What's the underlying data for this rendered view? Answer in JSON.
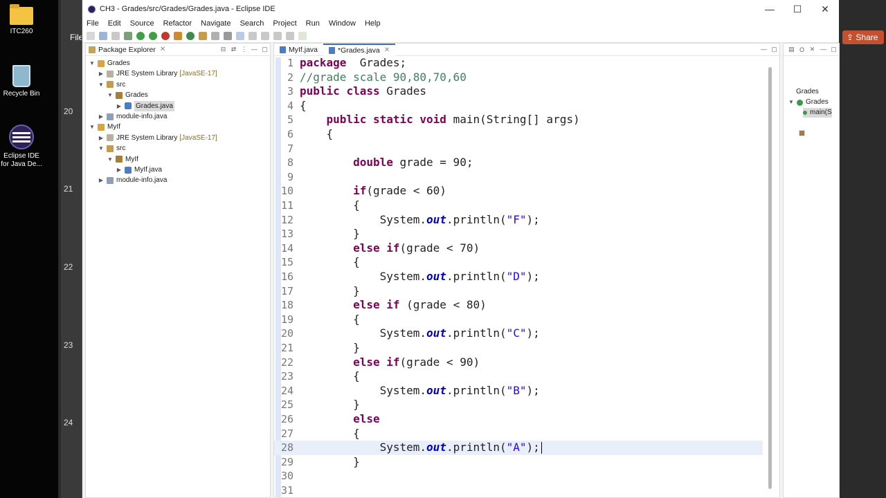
{
  "desktop": {
    "icons": [
      {
        "label": "ITC260"
      },
      {
        "label": "Recycle Bin"
      },
      {
        "label_line1": "Eclipse IDE",
        "label_line2": "for Java De..."
      }
    ]
  },
  "background_app": {
    "file_label": "File",
    "slide_numbers": [
      "20",
      "21",
      "22",
      "23",
      "24"
    ],
    "share_label": "Share"
  },
  "window": {
    "title": "CH3 - Grades/src/Grades/Grades.java - Eclipse IDE",
    "controls": {
      "minimize": "—",
      "maximize": "☐",
      "close": "✕"
    }
  },
  "menu": [
    "File",
    "Edit",
    "Source",
    "Refactor",
    "Navigate",
    "Search",
    "Project",
    "Run",
    "Window",
    "Help"
  ],
  "package_explorer": {
    "title": "Package Explorer",
    "tree": [
      {
        "label": "Grades",
        "type": "proj",
        "expanded": true,
        "depth": 0
      },
      {
        "label": "JRE System Library",
        "extra": "[JavaSE-17]",
        "type": "lib",
        "expanded": false,
        "depth": 1
      },
      {
        "label": "src",
        "type": "srcf",
        "expanded": true,
        "depth": 1
      },
      {
        "label": "Grades",
        "type": "pkgf",
        "expanded": true,
        "depth": 2
      },
      {
        "label": "Grades.java",
        "type": "javaf",
        "expanded": false,
        "depth": 3,
        "selected": true
      },
      {
        "label": "module-info.java",
        "type": "mod",
        "expanded": false,
        "depth": 1
      },
      {
        "label": "MyIf",
        "type": "proj",
        "expanded": true,
        "depth": 0
      },
      {
        "label": "JRE System Library",
        "extra": "[JavaSE-17]",
        "type": "lib",
        "expanded": false,
        "depth": 1
      },
      {
        "label": "src",
        "type": "srcf",
        "expanded": true,
        "depth": 1
      },
      {
        "label": "MyIf",
        "type": "pkgf",
        "expanded": true,
        "depth": 2
      },
      {
        "label": "MyIf.java",
        "type": "javaf",
        "expanded": false,
        "depth": 3
      },
      {
        "label": "module-info.java",
        "type": "mod",
        "expanded": false,
        "depth": 1
      }
    ]
  },
  "editor": {
    "tabs": [
      {
        "label": "MyIf.java",
        "active": false
      },
      {
        "label": "*Grades.java",
        "active": true
      }
    ],
    "current_line": 28,
    "lines": [
      {
        "n": "1",
        "tokens": [
          [
            "kw",
            "package"
          ],
          [
            "",
            "  Grades;"
          ]
        ]
      },
      {
        "n": "2",
        "tokens": [
          [
            "cmt",
            "//grade scale 90,80,70,60"
          ]
        ]
      },
      {
        "n": "3",
        "tokens": [
          [
            "kw",
            "public"
          ],
          [
            "",
            " "
          ],
          [
            "kw",
            "class"
          ],
          [
            "",
            " Grades"
          ]
        ]
      },
      {
        "n": "4",
        "tokens": [
          [
            "",
            "{"
          ]
        ]
      },
      {
        "n": "5",
        "tokens": [
          [
            "",
            "    "
          ],
          [
            "kw",
            "public"
          ],
          [
            "",
            " "
          ],
          [
            "kw",
            "static"
          ],
          [
            "",
            " "
          ],
          [
            "kw",
            "void"
          ],
          [
            "",
            " main(String[] args)"
          ]
        ]
      },
      {
        "n": "6",
        "tokens": [
          [
            "",
            "    {"
          ]
        ]
      },
      {
        "n": "7",
        "tokens": [
          [
            "",
            ""
          ]
        ]
      },
      {
        "n": "8",
        "tokens": [
          [
            "",
            "        "
          ],
          [
            "kw",
            "double"
          ],
          [
            "",
            " grade = 90;"
          ]
        ]
      },
      {
        "n": "9",
        "tokens": [
          [
            "",
            ""
          ]
        ]
      },
      {
        "n": "10",
        "tokens": [
          [
            "",
            "        "
          ],
          [
            "kw",
            "if"
          ],
          [
            "",
            "(grade < 60)"
          ]
        ]
      },
      {
        "n": "11",
        "tokens": [
          [
            "",
            "        {"
          ]
        ]
      },
      {
        "n": "12",
        "tokens": [
          [
            "",
            "            System."
          ],
          [
            "fld",
            "out"
          ],
          [
            "",
            ".println("
          ],
          [
            "str",
            "\"F\""
          ],
          [
            "",
            ");"
          ]
        ]
      },
      {
        "n": "13",
        "tokens": [
          [
            "",
            "        }"
          ]
        ]
      },
      {
        "n": "14",
        "tokens": [
          [
            "",
            "        "
          ],
          [
            "kw",
            "else"
          ],
          [
            "",
            " "
          ],
          [
            "kw",
            "if"
          ],
          [
            "",
            "(grade < 70)"
          ]
        ]
      },
      {
        "n": "15",
        "tokens": [
          [
            "",
            "        {"
          ]
        ]
      },
      {
        "n": "16",
        "tokens": [
          [
            "",
            "            System."
          ],
          [
            "fld",
            "out"
          ],
          [
            "",
            ".println("
          ],
          [
            "str",
            "\"D\""
          ],
          [
            "",
            ");"
          ]
        ]
      },
      {
        "n": "17",
        "tokens": [
          [
            "",
            "        }"
          ]
        ]
      },
      {
        "n": "18",
        "tokens": [
          [
            "",
            "        "
          ],
          [
            "kw",
            "else"
          ],
          [
            "",
            " "
          ],
          [
            "kw",
            "if"
          ],
          [
            "",
            " (grade < 80)"
          ]
        ]
      },
      {
        "n": "19",
        "tokens": [
          [
            "",
            "        {"
          ]
        ]
      },
      {
        "n": "20",
        "tokens": [
          [
            "",
            "            System."
          ],
          [
            "fld",
            "out"
          ],
          [
            "",
            ".println("
          ],
          [
            "str",
            "\"C\""
          ],
          [
            "",
            ");"
          ]
        ]
      },
      {
        "n": "21",
        "tokens": [
          [
            "",
            "        }"
          ]
        ]
      },
      {
        "n": "22",
        "tokens": [
          [
            "",
            "        "
          ],
          [
            "kw",
            "else"
          ],
          [
            "",
            " "
          ],
          [
            "kw",
            "if"
          ],
          [
            "",
            "(grade < 90)"
          ]
        ]
      },
      {
        "n": "23",
        "tokens": [
          [
            "",
            "        {"
          ]
        ]
      },
      {
        "n": "24",
        "tokens": [
          [
            "",
            "            System."
          ],
          [
            "fld",
            "out"
          ],
          [
            "",
            ".println("
          ],
          [
            "str",
            "\"B\""
          ],
          [
            "",
            ");"
          ]
        ]
      },
      {
        "n": "25",
        "tokens": [
          [
            "",
            "        }"
          ]
        ]
      },
      {
        "n": "26",
        "tokens": [
          [
            "",
            "        "
          ],
          [
            "kw",
            "else"
          ]
        ]
      },
      {
        "n": "27",
        "tokens": [
          [
            "",
            "        {"
          ]
        ]
      },
      {
        "n": "28",
        "tokens": [
          [
            "",
            "            System."
          ],
          [
            "fld",
            "out"
          ],
          [
            "",
            ".println("
          ],
          [
            "str",
            "\"A\""
          ],
          [
            "",
            ");"
          ]
        ]
      },
      {
        "n": "29",
        "tokens": [
          [
            "",
            "        }"
          ]
        ]
      },
      {
        "n": "30",
        "tokens": [
          [
            "",
            ""
          ]
        ]
      },
      {
        "n": "31",
        "tokens": [
          [
            "",
            ""
          ]
        ]
      }
    ]
  },
  "outline": {
    "items": [
      {
        "label": "Grades",
        "icon": "package-icon",
        "depth": 0
      },
      {
        "label": "Grades",
        "icon": "class-icon",
        "depth": 0,
        "expanded": true
      },
      {
        "label": "main(S",
        "icon": "method-icon",
        "depth": 1,
        "selected": true
      }
    ]
  },
  "colors": {
    "keyword": "#7f0055",
    "comment": "#3f7f5f",
    "string": "#2a00ff",
    "field": "#0000c0",
    "share_button": "#c3502f"
  }
}
